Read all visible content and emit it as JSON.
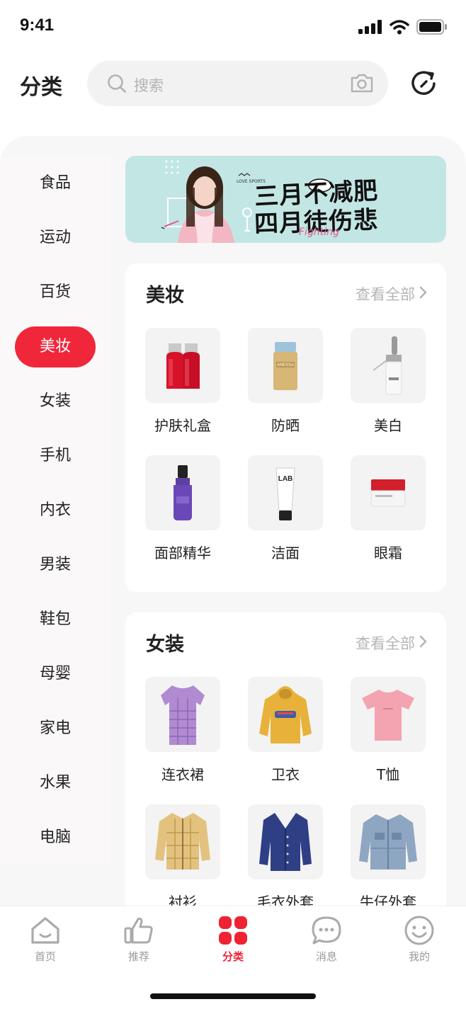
{
  "status_bar": {
    "time": "9:41"
  },
  "header": {
    "title": "分类",
    "search_placeholder": "搜索",
    "icons": [
      "search-icon",
      "camera-icon",
      "refresh-icon"
    ]
  },
  "sidebar": {
    "active_index": 3,
    "items": [
      {
        "label": "食品"
      },
      {
        "label": "运动"
      },
      {
        "label": "百货"
      },
      {
        "label": "美妆"
      },
      {
        "label": "女装"
      },
      {
        "label": "手机"
      },
      {
        "label": "内衣"
      },
      {
        "label": "男装"
      },
      {
        "label": "鞋包"
      },
      {
        "label": "母婴"
      },
      {
        "label": "家电"
      },
      {
        "label": "水果"
      },
      {
        "label": "电脑"
      }
    ]
  },
  "banner": {
    "line1": "三月不减肥",
    "line2": "四月徒伤悲",
    "small_text": "LOVE SPORTS",
    "script_text": "Fighting"
  },
  "sections": [
    {
      "title": "美妆",
      "more": "查看全部",
      "items": [
        {
          "label": "护肤礼盒",
          "icon": "serum-gift-box-icon"
        },
        {
          "label": "防晒",
          "icon": "sunscreen-icon"
        },
        {
          "label": "美白",
          "icon": "dropper-bottle-icon"
        },
        {
          "label": "面部精华",
          "icon": "essence-bottle-icon"
        },
        {
          "label": "洁面",
          "icon": "cleanser-tube-icon"
        },
        {
          "label": "眼霜",
          "icon": "eye-cream-jar-icon"
        }
      ]
    },
    {
      "title": "女装",
      "more": "查看全部",
      "items": [
        {
          "label": "连衣裙",
          "icon": "dress-icon"
        },
        {
          "label": "卫衣",
          "icon": "hoodie-icon"
        },
        {
          "label": "T恤",
          "icon": "tshirt-icon"
        },
        {
          "label": "衬衫",
          "icon": "shirt-icon"
        },
        {
          "label": "毛衣外套",
          "icon": "cardigan-icon"
        },
        {
          "label": "牛仔外套",
          "icon": "denim-jacket-icon"
        }
      ]
    }
  ],
  "tab_bar": {
    "active_index": 2,
    "items": [
      {
        "label": "首页",
        "icon": "home-icon"
      },
      {
        "label": "推荐",
        "icon": "thumbs-up-icon"
      },
      {
        "label": "分类",
        "icon": "category-grid-icon"
      },
      {
        "label": "消息",
        "icon": "message-icon"
      },
      {
        "label": "我的",
        "icon": "smiley-profile-icon"
      }
    ]
  },
  "colors": {
    "accent": "#f0273a",
    "banner_bg": "#c2e6e4",
    "tile_bg": "#f3f3f3",
    "muted_text": "#b5b5b5"
  }
}
